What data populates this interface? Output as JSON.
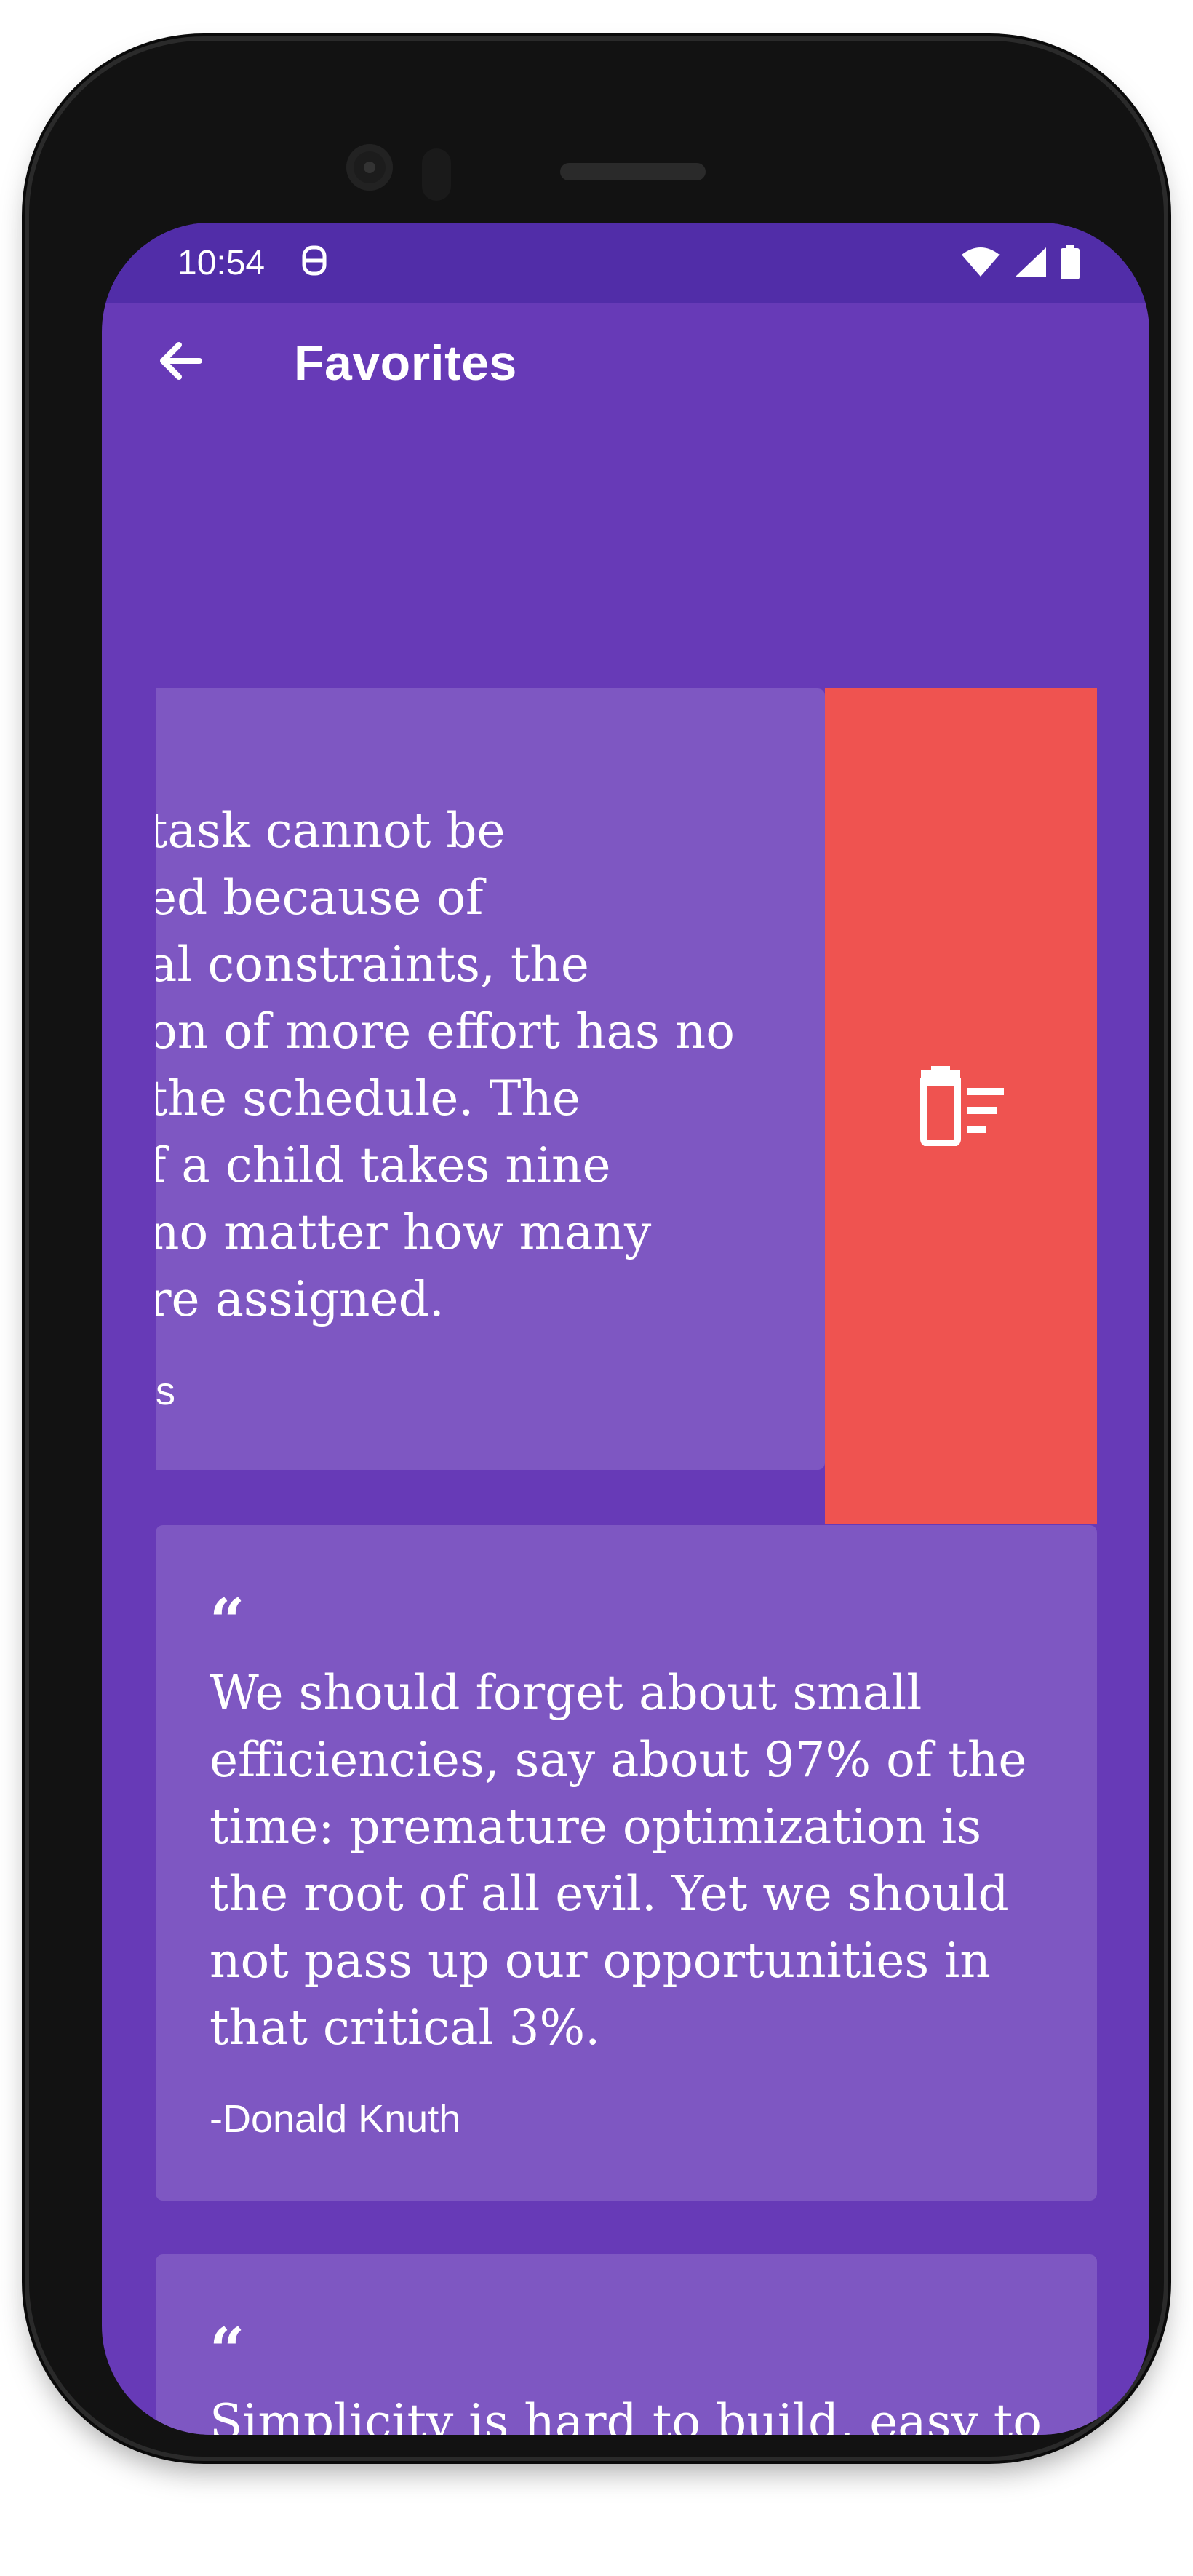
{
  "status_bar": {
    "time": "10:54"
  },
  "app_bar": {
    "title": "Favorites"
  },
  "quotes": [
    {
      "visible_lines": [
        "task cannot be",
        "ed because of",
        "al constraints, the",
        "on of more effort has no",
        "the schedule. The",
        "f a child takes nine",
        "no matter how many",
        "re assigned."
      ],
      "author_fragment": "s",
      "swipe_state": "swiped-left-revealing-delete",
      "delete_icon": "delete-sweep-icon"
    },
    {
      "text": "We should forget about small efficiencies, say about 97% of the time: premature optimization is the root of all evil. Yet we should not pass up our opportunities in that critical 3%.",
      "author": "-Donald Knuth"
    },
    {
      "text": "Simplicity is hard to build, easy to use, and hard to charge for. Complexity is easy to build, hard",
      "author": ""
    }
  ],
  "colors": {
    "status_bar": "#512da8",
    "primary": "#673ab7",
    "card": "#7e57c2",
    "delete": "#ef5350",
    "text": "#ffffff"
  }
}
